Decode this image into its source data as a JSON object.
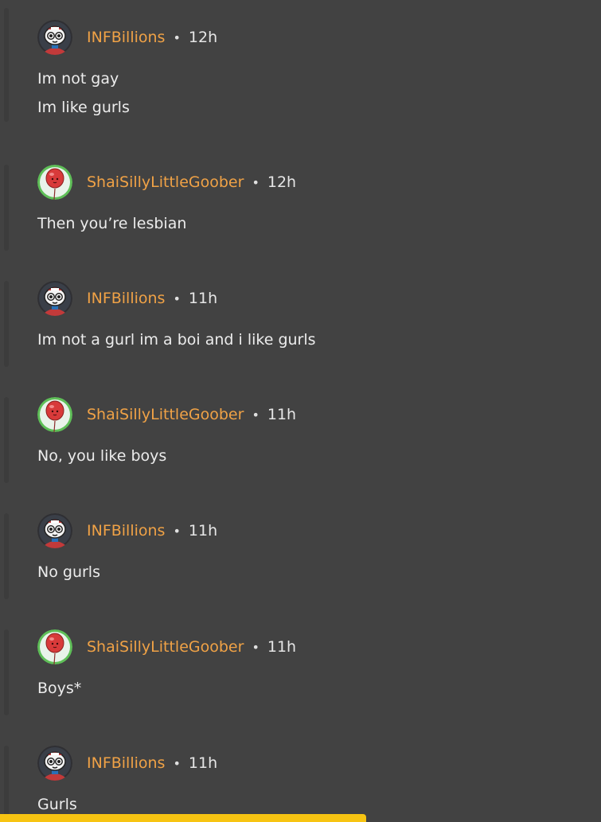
{
  "comments": [
    {
      "user": "INFBillions",
      "avatar": "robot-avatar",
      "sep": "•",
      "time": "12h",
      "lines": [
        "Im not gay",
        "Im like gurls"
      ]
    },
    {
      "user": "ShaiSillyLittleGoober",
      "avatar": "balloon-avatar",
      "sep": "•",
      "time": "12h",
      "lines": [
        "Then you’re lesbian"
      ]
    },
    {
      "user": "INFBillions",
      "avatar": "robot-avatar",
      "sep": "•",
      "time": "11h",
      "lines": [
        "Im not a gurl im a boi and i like gurls"
      ]
    },
    {
      "user": "ShaiSillyLittleGoober",
      "avatar": "balloon-avatar",
      "sep": "•",
      "time": "11h",
      "lines": [
        "No, you like boys"
      ]
    },
    {
      "user": "INFBillions",
      "avatar": "robot-avatar",
      "sep": "•",
      "time": "11h",
      "lines": [
        "No gurls"
      ]
    },
    {
      "user": "ShaiSillyLittleGoober",
      "avatar": "balloon-avatar",
      "sep": "•",
      "time": "11h",
      "lines": [
        "Boys*"
      ]
    },
    {
      "user": "INFBillions",
      "avatar": "robot-avatar",
      "sep": "•",
      "time": "11h",
      "lines": [
        "Gurls"
      ]
    }
  ],
  "colors": {
    "background": "#424242",
    "username": "#f0a246",
    "text": "#ececec",
    "bottom_bar": "#f7c412"
  }
}
